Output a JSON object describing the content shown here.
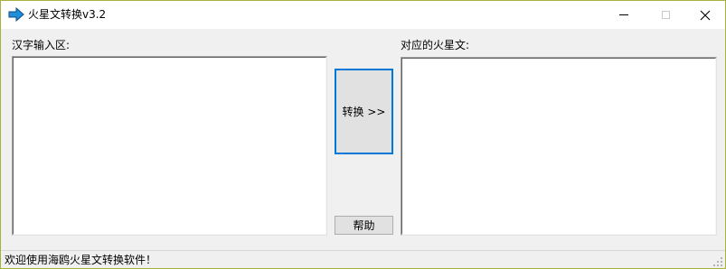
{
  "window": {
    "title": "火星文转换v3.2",
    "icon": "blue-arrow-right-icon"
  },
  "labels": {
    "input": "汉字输入区:",
    "output": "对应的火星文:"
  },
  "fields": {
    "input_value": "",
    "output_value": ""
  },
  "buttons": {
    "convert": "转换 >>",
    "help": "帮助"
  },
  "status": {
    "text": "欢迎使用海鸥火星文转换软件！"
  },
  "colors": {
    "focus_border": "#0078d7",
    "window_border": "#a8b23b",
    "app_icon": "#1e8fd8"
  }
}
